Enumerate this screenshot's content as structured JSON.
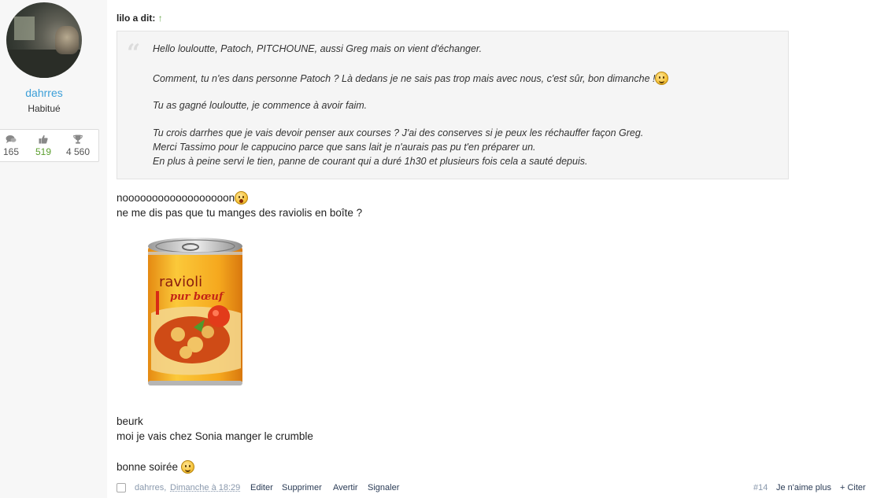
{
  "user": {
    "name": "dahrres",
    "title": "Habitué",
    "stats": {
      "messages": "165",
      "likes": "519",
      "points": "4 560"
    }
  },
  "quote": {
    "author": "lilo a dit:",
    "arrow": "↑",
    "lines": [
      "Hello louloutte, Patoch, PITCHOUNE, aussi Greg mais on vient d'échanger.",
      "Comment, tu n'es dans personne Patoch ? Là dedans je ne sais pas trop mais avec nous, c'est sûr, bon dimanche !",
      "Tu as gagné louloutte, je commence à avoir faim.",
      "Tu crois darrhes que je vais devoir penser aux courses ? J'ai des conserves si je peux les réchauffer façon Greg.",
      "Merci Tassimo pour le cappucino parce que sans lait je n'aurais pas pu t'en préparer un.",
      "En plus à peine servi le tien, panne de courant qui a duré 1h30 et plusieurs fois cela a sauté depuis."
    ]
  },
  "message": {
    "line1": "noooooooooooooooooon",
    "line2": "ne me dis pas que tu manges des raviolis en boîte ?",
    "can_label_1": "ravioli",
    "can_label_2": "pur bœuf",
    "line3": "beurk",
    "line4": "moi je vais chez Sonia manger le crumble",
    "line5": "bonne soirée"
  },
  "footer": {
    "author": "dahrres,",
    "date": "Dimanche à 18:29",
    "edit": "Editer",
    "delete": "Supprimer",
    "warn": "Avertir",
    "report": "Signaler",
    "post_number": "#14",
    "unlike": "Je n'aime plus",
    "quote": "+ Citer"
  },
  "colors": {
    "link": "#3c9fd8",
    "likes": "#5b9e2e",
    "quote_bg": "#f5f5f5",
    "sidebar_bg": "#f7f7f7"
  }
}
